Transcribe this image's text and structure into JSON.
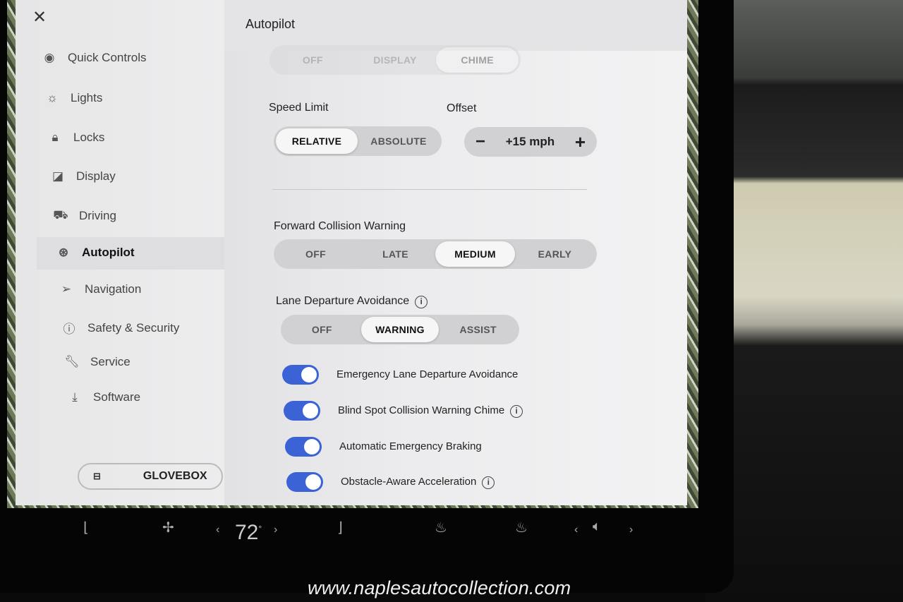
{
  "sidebar": {
    "items": [
      {
        "label": "Quick Controls",
        "icon": "toggle-icon"
      },
      {
        "label": "Lights",
        "icon": "light-bulb-icon"
      },
      {
        "label": "Locks",
        "icon": "lock-icon"
      },
      {
        "label": "Display",
        "icon": "display-icon"
      },
      {
        "label": "Driving",
        "icon": "car-icon"
      },
      {
        "label": "Autopilot",
        "icon": "steering-wheel-icon",
        "active": true
      },
      {
        "label": "Navigation",
        "icon": "navigation-arrow-icon"
      },
      {
        "label": "Safety & Security",
        "icon": "alert-circle-icon"
      },
      {
        "label": "Service",
        "icon": "wrench-icon"
      },
      {
        "label": "Software",
        "icon": "download-icon"
      }
    ],
    "glovebox": "GLOVEBOX"
  },
  "header": {
    "title": "Autopilot"
  },
  "speed_warning": {
    "options": [
      "OFF",
      "DISPLAY",
      "CHIME"
    ],
    "selected": "CHIME"
  },
  "speed_limit": {
    "label": "Speed Limit",
    "options": [
      "RELATIVE",
      "ABSOLUTE"
    ],
    "selected": "RELATIVE"
  },
  "offset": {
    "label": "Offset",
    "value": "+15 mph",
    "minus": "−",
    "plus": "+"
  },
  "fcw": {
    "label": "Forward Collision Warning",
    "options": [
      "OFF",
      "LATE",
      "MEDIUM",
      "EARLY"
    ],
    "selected": "MEDIUM"
  },
  "lda": {
    "label": "Lane Departure Avoidance",
    "options": [
      "OFF",
      "WARNING",
      "ASSIST"
    ],
    "selected": "WARNING"
  },
  "toggles": [
    {
      "label": "Emergency Lane Departure Avoidance",
      "on": true,
      "info": false
    },
    {
      "label": "Blind Spot Collision Warning Chime",
      "on": true,
      "info": true
    },
    {
      "label": "Automatic Emergency Braking",
      "on": true,
      "info": false
    },
    {
      "label": "Obstacle-Aware Acceleration",
      "on": true,
      "info": true
    }
  ],
  "colors": {
    "toggle_on": "#3b63d6"
  },
  "climate_bar": {
    "temperature": "72",
    "degree": "°"
  },
  "watermark": "www.naplesautocollection.com"
}
